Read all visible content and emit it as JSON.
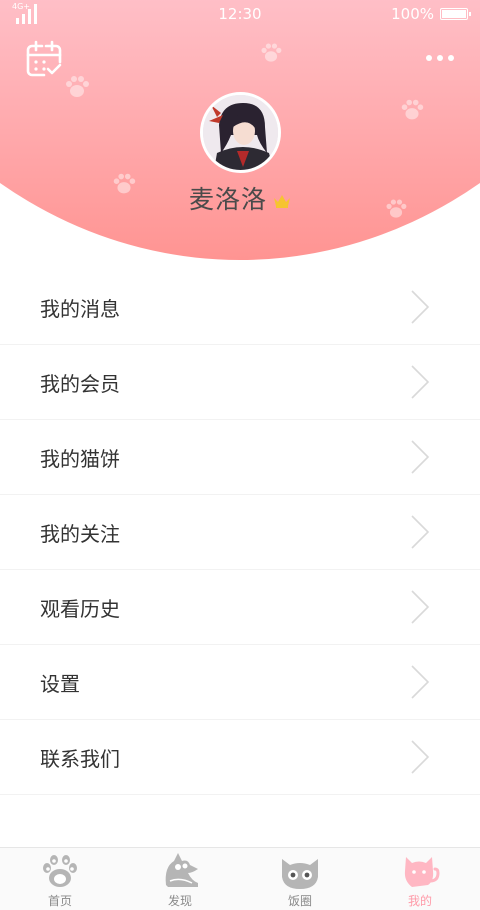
{
  "status_bar": {
    "network": "4G+",
    "time": "12:30",
    "battery": "100%"
  },
  "profile": {
    "username": "麦洛洛"
  },
  "menu": [
    {
      "label": "我的消息"
    },
    {
      "label": "我的会员"
    },
    {
      "label": "我的猫饼"
    },
    {
      "label": "我的关注"
    },
    {
      "label": "观看历史"
    },
    {
      "label": "设置"
    },
    {
      "label": "联系我们"
    }
  ],
  "tabs": [
    {
      "label": "首页",
      "icon": "paw-icon",
      "active": false
    },
    {
      "label": "发现",
      "icon": "cat-discover-icon",
      "active": false
    },
    {
      "label": "饭圈",
      "icon": "cat-face-icon",
      "active": false
    },
    {
      "label": "我的",
      "icon": "cat-me-icon",
      "active": true
    }
  ],
  "colors": {
    "header_top": "#ffc2cb",
    "header_bottom": "#ff9492",
    "accent": "#ff9aa8",
    "tab_inactive": "#8a8a8a"
  }
}
